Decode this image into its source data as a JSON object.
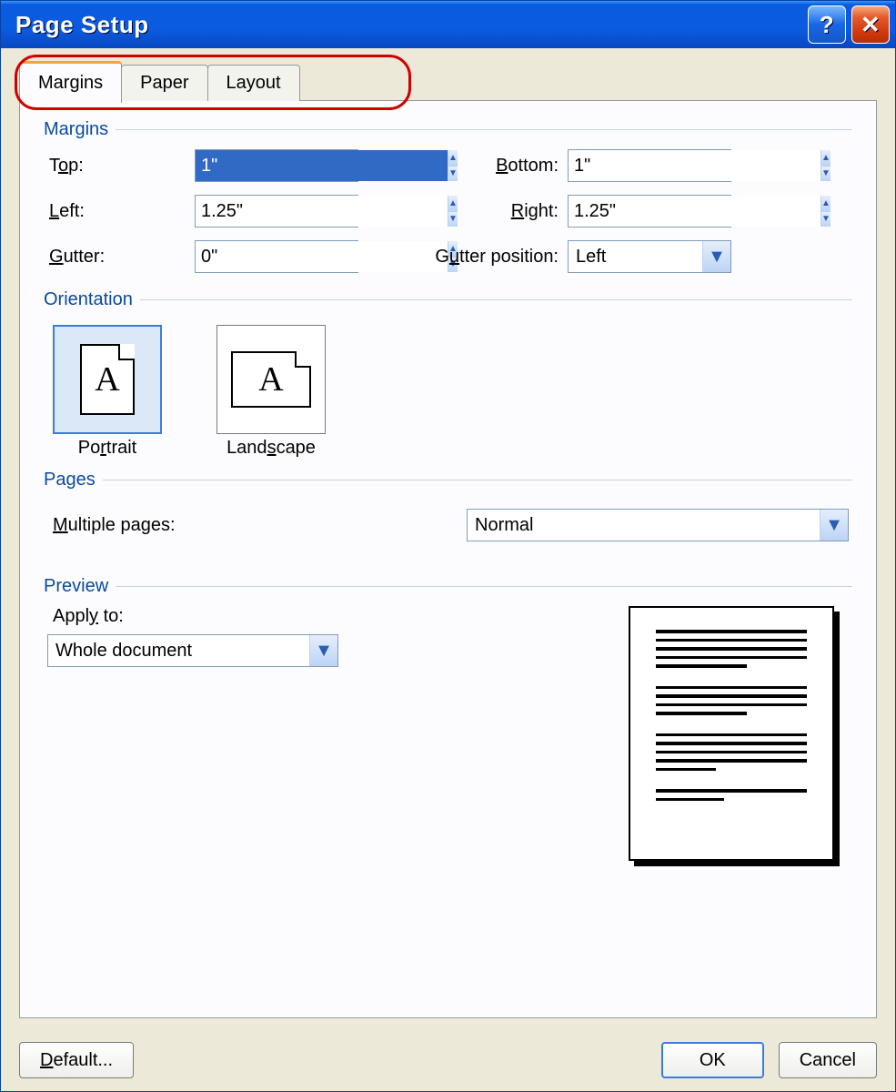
{
  "title": "Page Setup",
  "tabs": {
    "margins": "Margins",
    "paper": "Paper",
    "layout": "Layout"
  },
  "sections": {
    "margins": "Margins",
    "orientation": "Orientation",
    "pages": "Pages",
    "preview": "Preview"
  },
  "labels": {
    "top_pre": "T",
    "top_u": "o",
    "top_post": "p:",
    "bottom_pre": "",
    "bottom_u": "B",
    "bottom_post": "ottom:",
    "left_pre": "",
    "left_u": "L",
    "left_post": "eft:",
    "right_pre": "",
    "right_u": "R",
    "right_post": "ight:",
    "gutter_pre": "",
    "gutter_u": "G",
    "gutter_post": "utter:",
    "gpos_pre": "G",
    "gpos_u": "u",
    "gpos_post": "tter position:",
    "multi_pre": "",
    "multi_u": "M",
    "multi_post": "ultiple pages:",
    "apply_pre": "Appl",
    "apply_u": "y",
    "apply_post": " to:",
    "portrait_pre": "Po",
    "portrait_u": "r",
    "portrait_post": "trait",
    "landscape_pre": "Land",
    "landscape_u": "s",
    "landscape_post": "cape"
  },
  "values": {
    "top": "1\"",
    "bottom": "1\"",
    "left": "1.25\"",
    "right": "1.25\"",
    "gutter": "0\"",
    "gutter_pos": "Left",
    "multiple_pages": "Normal",
    "apply_to": "Whole document"
  },
  "buttons": {
    "default_pre": "",
    "default_u": "D",
    "default_post": "efault...",
    "ok": "OK",
    "cancel": "Cancel"
  }
}
